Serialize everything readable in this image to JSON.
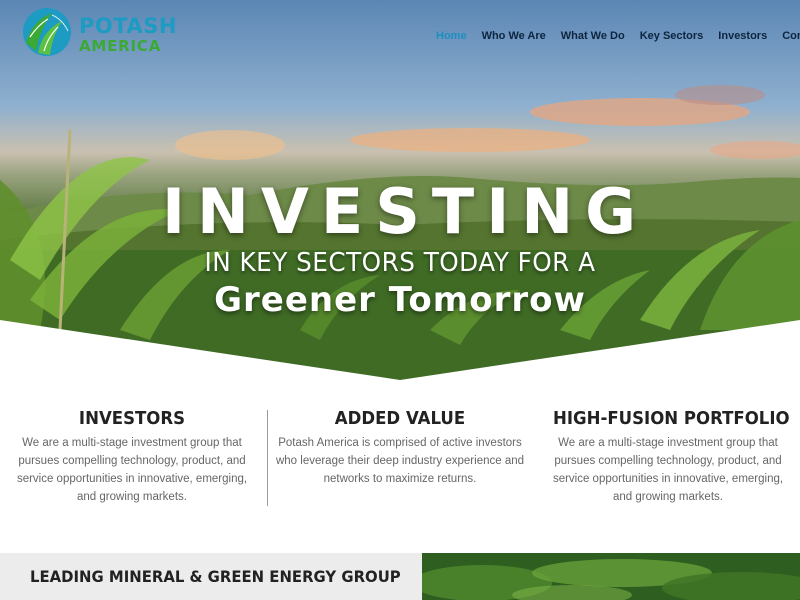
{
  "brand": {
    "name_top": "POTASH",
    "name_bottom": "AMERICA",
    "colors": {
      "blue": "#1d9bc2",
      "green": "#3aaa35"
    },
    "logo_icon": "leaf-globe-icon"
  },
  "nav": {
    "items": [
      {
        "label": "Home",
        "active": true
      },
      {
        "label": "Who We Are",
        "active": false
      },
      {
        "label": "What We Do",
        "active": false
      },
      {
        "label": "Key Sectors",
        "active": false
      },
      {
        "label": "Investors",
        "active": false
      },
      {
        "label": "Contact",
        "active": false
      }
    ],
    "active_color": "#1c8fc1",
    "text_color": "#0d2540"
  },
  "hero": {
    "title": "INVESTING",
    "subtitle": "IN KEY SECTORS TODAY FOR A",
    "tagline": "Greener Tomorrow"
  },
  "features": [
    {
      "title": "INVESTORS",
      "body": "We are a multi-stage investment group that pursues compelling technology, product, and service opportunities in innovative, emerging, and growing markets."
    },
    {
      "title": "ADDED VALUE",
      "body": "Potash America is comprised of active investors who leverage their deep industry experience and networks to maximize returns."
    },
    {
      "title": "HIGH-FUSION PORTFOLIO",
      "body": "We are a multi-stage investment group that pursues compelling technology, product, and service opportunities in innovative, emerging, and growing markets."
    }
  ],
  "section": {
    "title": "LEADING MINERAL & GREEN ENERGY GROUP"
  }
}
